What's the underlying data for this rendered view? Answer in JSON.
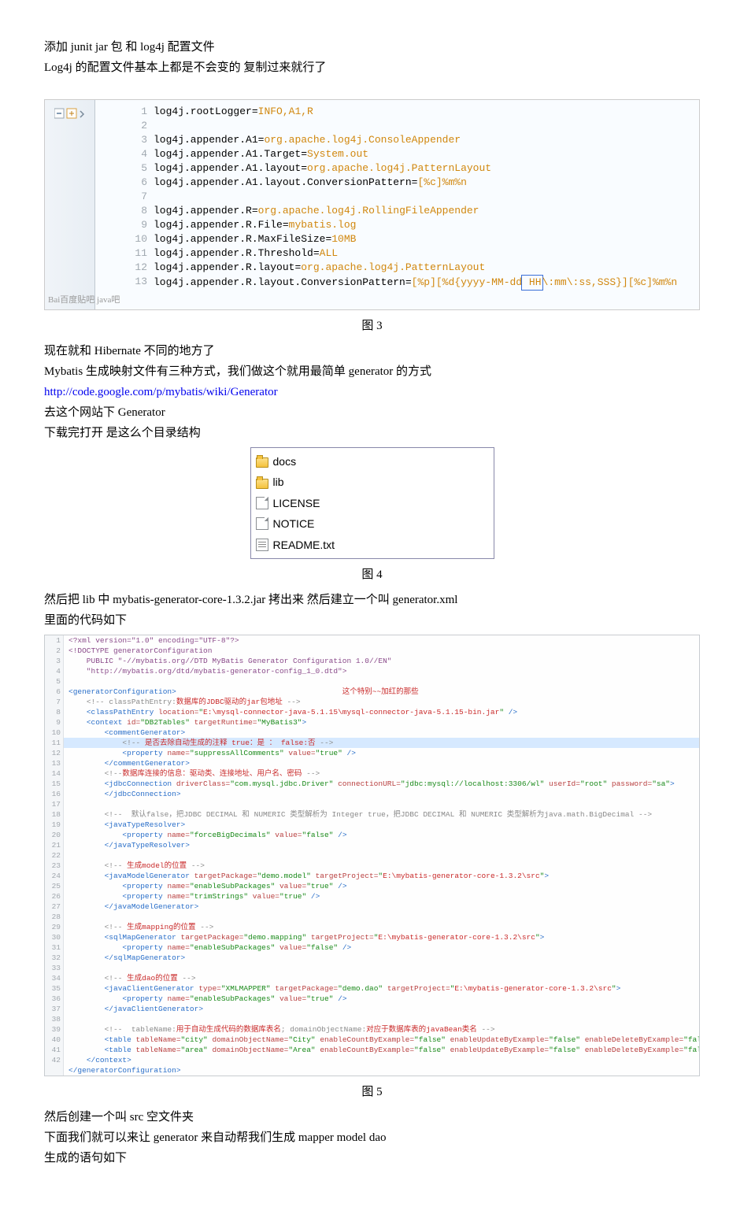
{
  "intro": {
    "line1": "添加 junit jar   包  和 log4j   配置文件",
    "line2": "Log4j 的配置文件基本上都是不会变的  复制过来就行了"
  },
  "fig3": {
    "caption": "图 3",
    "watermark": "Bai百度贴吧    java吧",
    "lines": [
      {
        "n": 1,
        "k": "log4j.rootLogger",
        "v": "INFO,A1,R"
      },
      {
        "n": 2,
        "blank": true
      },
      {
        "n": 3,
        "k": "log4j.appender.A1",
        "v": "org.apache.log4j.ConsoleAppender"
      },
      {
        "n": 4,
        "k": "log4j.appender.A1.Target",
        "v": "System.out"
      },
      {
        "n": 5,
        "k": "log4j.appender.A1.layout",
        "v": "org.apache.log4j.PatternLayout"
      },
      {
        "n": 6,
        "k": "log4j.appender.A1.layout.ConversionPattern",
        "v": "[%c]%m%n"
      },
      {
        "n": 7,
        "blank": true
      },
      {
        "n": 8,
        "k": "log4j.appender.R",
        "v": "org.apache.log4j.RollingFileAppender"
      },
      {
        "n": 9,
        "k": "log4j.appender.R.File",
        "v": "mybatis.log"
      },
      {
        "n": 10,
        "k": "log4j.appender.R.MaxFileSize",
        "v": "10MB"
      },
      {
        "n": 11,
        "k": "log4j.appender.R.Threshold",
        "v": "ALL"
      },
      {
        "n": 12,
        "k": "log4j.appender.R.layout",
        "v": "org.apache.log4j.PatternLayout"
      },
      {
        "n": 13,
        "k": "log4j.appender.R.layout.ConversionPattern",
        "v_pre": "[%p][%d{yyyy-MM-dd",
        "v_box": " HH",
        "v_post": "\\:mm\\:ss,SSS}][%c]%m%n"
      }
    ]
  },
  "mid": {
    "p1": "现在就和 Hibernate 不同的地方了",
    "p2": "Mybatis   生成映射文件有三种方式，我们做这个就用最简单 generator   的方式",
    "p3_url": "http://code.google.com/p/mybatis/wiki/Generator",
    "p4": "去这个网站下 Generator",
    "p5": "下载完打开  是这么个目录结构"
  },
  "fig4": {
    "caption": "图 4",
    "items": [
      {
        "icon": "folder",
        "name": "docs"
      },
      {
        "icon": "folder",
        "name": "lib"
      },
      {
        "icon": "file",
        "name": "LICENSE"
      },
      {
        "icon": "file",
        "name": "NOTICE"
      },
      {
        "icon": "txt",
        "name": "README.txt"
      }
    ]
  },
  "after4": {
    "p1": "然后把 lib 中  mybatis-generator-core-1.3.2.jar    拷出来  然后建立一个叫 generator.xml",
    "p2": "里面的代码如下"
  },
  "fig5": {
    "caption": "图 5",
    "xml": [
      {
        "n": 1,
        "cls": "",
        "html": "<span class='x-decl'>&lt;?xml version=\"1.0\" encoding=\"UTF-8\"?&gt;</span>"
      },
      {
        "n": 2,
        "cls": "",
        "html": "<span class='x-decl'>&lt;!DOCTYPE generatorConfiguration</span>"
      },
      {
        "n": 3,
        "cls": "",
        "html": "<span class='x-decl'>    PUBLIC \"-//mybatis.org//DTD MyBatis Generator Configuration 1.0//EN\"</span>"
      },
      {
        "n": 4,
        "cls": "",
        "html": "<span class='x-decl'>    \"http://mybatis.org/dtd/mybatis-generator-config_1_0.dtd\"&gt;</span>"
      },
      {
        "n": 5,
        "cls": "",
        "html": ""
      },
      {
        "n": 6,
        "cls": "",
        "html": "<span class='x-tag'>&lt;generatorConfiguration&gt;</span>                                     <span class='x-cn'>这个特别~~加红的那些</span>"
      },
      {
        "n": 7,
        "cls": "",
        "html": "    <span class='x-comment'>&lt;!-- classPathEntry:</span><span class='x-cn'>数据库的JDBC驱动的jar包地址</span><span class='x-comment'> --&gt;</span>"
      },
      {
        "n": 8,
        "cls": "",
        "html": "    <span class='x-tag'>&lt;classPathEntry</span> <span class='x-attr'>location=</span><span class='x-str'>\"</span><span class='x-cn'>E:\\mysql-connector-java-5.1.15\\mysql-connector-java-5.1.15-bin.jar</span><span class='x-str'>\"</span> <span class='x-tag'>/&gt;</span>"
      },
      {
        "n": 9,
        "cls": "",
        "html": "    <span class='x-tag'>&lt;context</span> <span class='x-attr'>id=</span><span class='x-str'>\"DB2Tables\"</span> <span class='x-attr'>targetRuntime=</span><span class='x-str'>\"MyBatis3\"</span><span class='x-tag'>&gt;</span>"
      },
      {
        "n": 10,
        "cls": "",
        "html": "        <span class='x-tag'>&lt;commentGenerator&gt;</span>"
      },
      {
        "n": 11,
        "cls": "hl-row",
        "html": "            <span class='x-comment'>&lt;!-- </span><span class='x-cn'>是否去除自动生成的注释 true：是 ： false:否</span><span class='x-comment'> --&gt;</span>"
      },
      {
        "n": 12,
        "cls": "",
        "html": "            <span class='x-tag'>&lt;property</span> <span class='x-attr'>name=</span><span class='x-str'>\"suppressAllComments\"</span> <span class='x-attr'>value=</span><span class='x-str'>\"true\"</span> <span class='x-tag'>/&gt;</span>"
      },
      {
        "n": 13,
        "cls": "",
        "html": "        <span class='x-tag'>&lt;/commentGenerator&gt;</span>"
      },
      {
        "n": 14,
        "cls": "",
        "html": "        <span class='x-comment'>&lt;!--</span><span class='x-cn'>数据库连接的信息：驱动类、连接地址、用户名、密码</span><span class='x-comment'> --&gt;</span>"
      },
      {
        "n": 15,
        "cls": "",
        "html": "        <span class='x-tag'>&lt;jdbcConnection</span> <span class='x-attr'>driverClass=</span><span class='x-str'>\"com.mysql.jdbc.Driver\"</span> <span class='x-attr'>connectionURL=</span><span class='x-str'>\"jdbc:mysql://localhost:3306/wl\"</span> <span class='x-attr'>userId=</span><span class='x-str'>\"root\"</span> <span class='x-attr'>password=</span><span class='x-str'>\"sa\"</span><span class='x-tag'>&gt;</span>"
      },
      {
        "n": 16,
        "cls": "",
        "html": "        <span class='x-tag'>&lt;/jdbcConnection&gt;</span>"
      },
      {
        "n": 17,
        "cls": "",
        "html": ""
      },
      {
        "n": 18,
        "cls": "",
        "html": "        <span class='x-comment'>&lt;!--  默认false，把JDBC DECIMAL 和 NUMERIC 类型解析为 Integer true，把JDBC DECIMAL 和 NUMERIC 类型解析为java.math.BigDecimal --&gt;</span>"
      },
      {
        "n": 19,
        "cls": "",
        "html": "        <span class='x-tag'>&lt;javaTypeResolver&gt;</span>"
      },
      {
        "n": 20,
        "cls": "",
        "html": "            <span class='x-tag'>&lt;property</span> <span class='x-attr'>name=</span><span class='x-str'>\"forceBigDecimals\"</span> <span class='x-attr'>value=</span><span class='x-str'>\"false\"</span> <span class='x-tag'>/&gt;</span>"
      },
      {
        "n": 21,
        "cls": "",
        "html": "        <span class='x-tag'>&lt;/javaTypeResolver&gt;</span>"
      },
      {
        "n": 22,
        "cls": "",
        "html": ""
      },
      {
        "n": 23,
        "cls": "",
        "html": "        <span class='x-comment'>&lt;!-- </span><span class='x-cn'>生成model的位置</span><span class='x-comment'> --&gt;</span>"
      },
      {
        "n": 24,
        "cls": "",
        "html": "        <span class='x-tag'>&lt;javaModelGenerator</span> <span class='x-attr'>targetPackage=</span><span class='x-str'>\"demo.model\"</span> <span class='x-attr'>targetProject=</span><span class='x-str'>\"</span><span class='x-cn'>E:\\mybatis-generator-core-1.3.2\\src</span><span class='x-str'>\"</span><span class='x-tag'>&gt;</span>"
      },
      {
        "n": 25,
        "cls": "",
        "html": "            <span class='x-tag'>&lt;property</span> <span class='x-attr'>name=</span><span class='x-str'>\"enableSubPackages\"</span> <span class='x-attr'>value=</span><span class='x-str'>\"true\"</span> <span class='x-tag'>/&gt;</span>"
      },
      {
        "n": 26,
        "cls": "",
        "html": "            <span class='x-tag'>&lt;property</span> <span class='x-attr'>name=</span><span class='x-str'>\"trimStrings\"</span> <span class='x-attr'>value=</span><span class='x-str'>\"true\"</span> <span class='x-tag'>/&gt;</span>"
      },
      {
        "n": 27,
        "cls": "",
        "html": "        <span class='x-tag'>&lt;/javaModelGenerator&gt;</span>"
      },
      {
        "n": 28,
        "cls": "",
        "html": ""
      },
      {
        "n": 29,
        "cls": "",
        "html": "        <span class='x-comment'>&lt;!-- </span><span class='x-cn'>生成mapping的位置</span><span class='x-comment'> --&gt;</span>"
      },
      {
        "n": 30,
        "cls": "",
        "html": "        <span class='x-tag'>&lt;sqlMapGenerator</span> <span class='x-attr'>targetPackage=</span><span class='x-str'>\"demo.mapping\"</span> <span class='x-attr'>targetProject=</span><span class='x-str'>\"</span><span class='x-cn'>E:\\mybatis-generator-core-1.3.2\\src</span><span class='x-str'>\"</span><span class='x-tag'>&gt;</span>"
      },
      {
        "n": 31,
        "cls": "",
        "html": "            <span class='x-tag'>&lt;property</span> <span class='x-attr'>name=</span><span class='x-str'>\"enableSubPackages\"</span> <span class='x-attr'>value=</span><span class='x-str'>\"false\"</span> <span class='x-tag'>/&gt;</span>"
      },
      {
        "n": 32,
        "cls": "",
        "html": "        <span class='x-tag'>&lt;/sqlMapGenerator&gt;</span>"
      },
      {
        "n": 33,
        "cls": "",
        "html": ""
      },
      {
        "n": 34,
        "cls": "",
        "html": "        <span class='x-comment'>&lt;!-- </span><span class='x-cn'>生成dao的位置</span><span class='x-comment'> --&gt;</span>"
      },
      {
        "n": 35,
        "cls": "",
        "html": "        <span class='x-tag'>&lt;javaClientGenerator</span> <span class='x-attr'>type=</span><span class='x-str'>\"XMLMAPPER\"</span> <span class='x-attr'>targetPackage=</span><span class='x-str'>\"demo.dao\"</span> <span class='x-attr'>targetProject=</span><span class='x-str'>\"</span><span class='x-cn'>E:\\mybatis-generator-core-1.3.2\\src</span><span class='x-str'>\"</span><span class='x-tag'>&gt;</span>"
      },
      {
        "n": 36,
        "cls": "",
        "html": "            <span class='x-tag'>&lt;property</span> <span class='x-attr'>name=</span><span class='x-str'>\"enableSubPackages\"</span> <span class='x-attr'>value=</span><span class='x-str'>\"true\"</span> <span class='x-tag'>/&gt;</span>"
      },
      {
        "n": 37,
        "cls": "",
        "html": "        <span class='x-tag'>&lt;/javaClientGenerator&gt;</span>"
      },
      {
        "n": 38,
        "cls": "",
        "html": ""
      },
      {
        "n": 39,
        "cls": "",
        "html": "        <span class='x-comment'>&lt;!--  tableName:</span><span class='x-cn'>用于自动生成代码的数据库表名</span><span class='x-comment'>; domainObjectName:</span><span class='x-cn'>对应于数据库表的javaBean类名</span><span class='x-comment'> --&gt;</span>"
      },
      {
        "n": 40,
        "cls": "",
        "html": "        <span class='x-tag'>&lt;table</span> <span class='x-attr'>tableName=</span><span class='x-str'>\"city\"</span> <span class='x-attr'>domainObjectName=</span><span class='x-str'>\"City\"</span> <span class='x-attr'>enableCountByExample=</span><span class='x-str'>\"false\"</span> <span class='x-attr'>enableUpdateByExample=</span><span class='x-str'>\"false\"</span> <span class='x-attr'>enableDeleteByExample=</span><span class='x-str'>\"false\"</span> <span class='x-attr'>enableSelectByExample=</span><span class='x-str'>\"false\"</span> <span class='x-attr'>selectByExampleQueryId=</span><span class='x-str'>\"false\"</span> <span class='x-tag'>/&gt;</span>"
      },
      {
        "n": 41,
        "cls": "",
        "html": "        <span class='x-tag'>&lt;table</span> <span class='x-attr'>tableName=</span><span class='x-str'>\"area\"</span> <span class='x-attr'>domainObjectName=</span><span class='x-str'>\"Area\"</span> <span class='x-attr'>enableCountByExample=</span><span class='x-str'>\"false\"</span> <span class='x-attr'>enableUpdateByExample=</span><span class='x-str'>\"false\"</span> <span class='x-attr'>enableDeleteByExample=</span><span class='x-str'>\"false\"</span> <span class='x-attr'>enableSelectByExample=</span><span class='x-str'>\"false\"</span> <span class='x-attr'>selectByExampleQueryId=</span><span class='x-str'>\"false\"</span> <span class='x-tag'>/&gt;</span>"
      },
      {
        "n": 42,
        "cls": "",
        "html": "    <span class='x-tag'>&lt;/context&gt;</span>"
      },
      {
        "n": "",
        "cls": "",
        "html": "<span class='x-tag'>&lt;/generatorConfiguration&gt;</span>"
      }
    ]
  },
  "outro": {
    "p1": "然后创建一个叫 src   空文件夹",
    "p2": "下面我们就可以来让 generator 来自动帮我们生成  mapper  model  dao",
    "p3": "生成的语句如下"
  }
}
